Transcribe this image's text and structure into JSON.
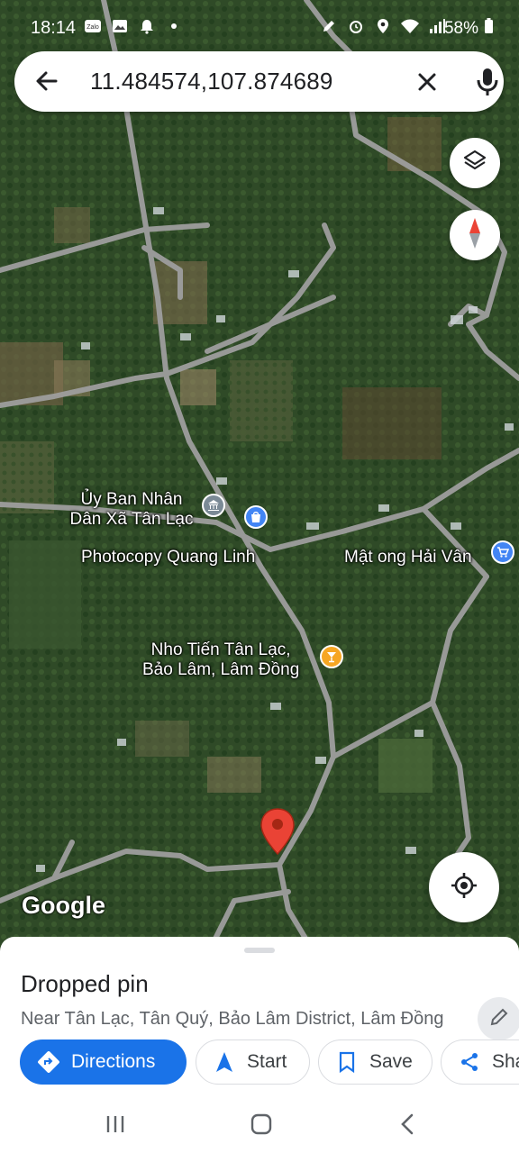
{
  "status_bar": {
    "time": "18:14",
    "battery": "58%",
    "left_icons": [
      "zalo-icon",
      "image-icon",
      "bell-icon",
      "dot-icon"
    ],
    "right_icons": [
      "pen-icon",
      "alarm-icon",
      "location-icon",
      "wifi-icon",
      "signal-icon",
      "battery-icon"
    ]
  },
  "search": {
    "query": "11.484574,107.874689"
  },
  "map": {
    "labels": {
      "ubnd": "Ủy Ban Nhân\nDân Xã Tân Lạc",
      "photocopy": "Photocopy Quang Linh",
      "matong": "Mật ong Hải Vân",
      "nhotien": "Nho Tiến Tân Lạc,\nBảo Lâm, Lâm Đồng"
    },
    "watermark": "Google",
    "colors": {
      "poi_gov": "#7b8a96",
      "poi_shop": "#4285f4",
      "poi_bar": "#f6a623",
      "pin": "#ea4335"
    }
  },
  "place": {
    "title": "Dropped pin",
    "subtitle": "Near Tân Lạc, Tân Quý, Bảo Lâm District, Lâm Đồng"
  },
  "actions": {
    "directions": "Directions",
    "start": "Start",
    "save": "Save",
    "share": "Share"
  }
}
